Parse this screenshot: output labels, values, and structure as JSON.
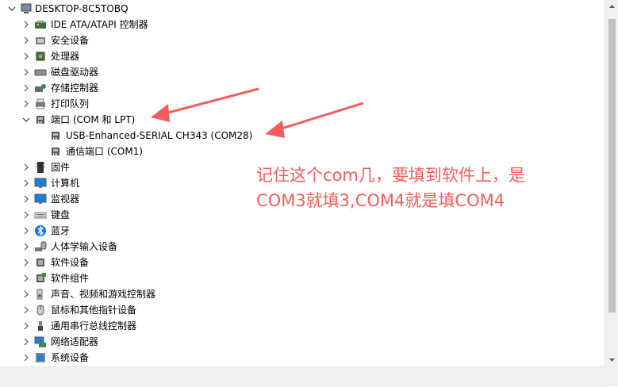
{
  "root": {
    "label": "DESKTOP-8C5TOBQ",
    "icon": "computer-icon"
  },
  "items": [
    {
      "label": "IDE ATA/ATAPI 控制器",
      "icon": "ide-controller-icon",
      "expanded": false
    },
    {
      "label": "安全设备",
      "icon": "security-device-icon",
      "expanded": false
    },
    {
      "label": "处理器",
      "icon": "processor-icon",
      "expanded": false
    },
    {
      "label": "磁盘驱动器",
      "icon": "disk-drive-icon",
      "expanded": false
    },
    {
      "label": "存储控制器",
      "icon": "storage-controller-icon",
      "expanded": false
    },
    {
      "label": "打印队列",
      "icon": "printer-icon",
      "expanded": false
    },
    {
      "label": "端口 (COM 和 LPT)",
      "icon": "port-icon",
      "expanded": true,
      "children": [
        {
          "label": "USB-Enhanced-SERIAL CH343 (COM28)",
          "icon": "port-icon"
        },
        {
          "label": "通信端口 (COM1)",
          "icon": "port-icon"
        }
      ]
    },
    {
      "label": "固件",
      "icon": "firmware-icon",
      "expanded": false
    },
    {
      "label": "计算机",
      "icon": "monitor-icon",
      "expanded": false
    },
    {
      "label": "监视器",
      "icon": "monitor-icon",
      "expanded": false
    },
    {
      "label": "键盘",
      "icon": "keyboard-icon",
      "expanded": false
    },
    {
      "label": "蓝牙",
      "icon": "bluetooth-icon",
      "expanded": false
    },
    {
      "label": "人体学输入设备",
      "icon": "hid-icon",
      "expanded": false
    },
    {
      "label": "软件设备",
      "icon": "software-device-icon",
      "expanded": false
    },
    {
      "label": "软件组件",
      "icon": "software-component-icon",
      "expanded": false
    },
    {
      "label": "声音、视频和游戏控制器",
      "icon": "speaker-icon",
      "expanded": false
    },
    {
      "label": "鼠标和其他指针设备",
      "icon": "mouse-icon",
      "expanded": false
    },
    {
      "label": "通用串行总线控制器",
      "icon": "usb-icon",
      "expanded": false
    },
    {
      "label": "网络适配器",
      "icon": "network-adapter-icon",
      "expanded": false
    },
    {
      "label": "系统设备",
      "icon": "system-device-icon",
      "expanded": false
    }
  ],
  "annotation": {
    "line1": "记住这个com几，要填到软件上，是",
    "line2": "COM3就填3,COM4就是填COM4",
    "color": "#f25d5d"
  }
}
